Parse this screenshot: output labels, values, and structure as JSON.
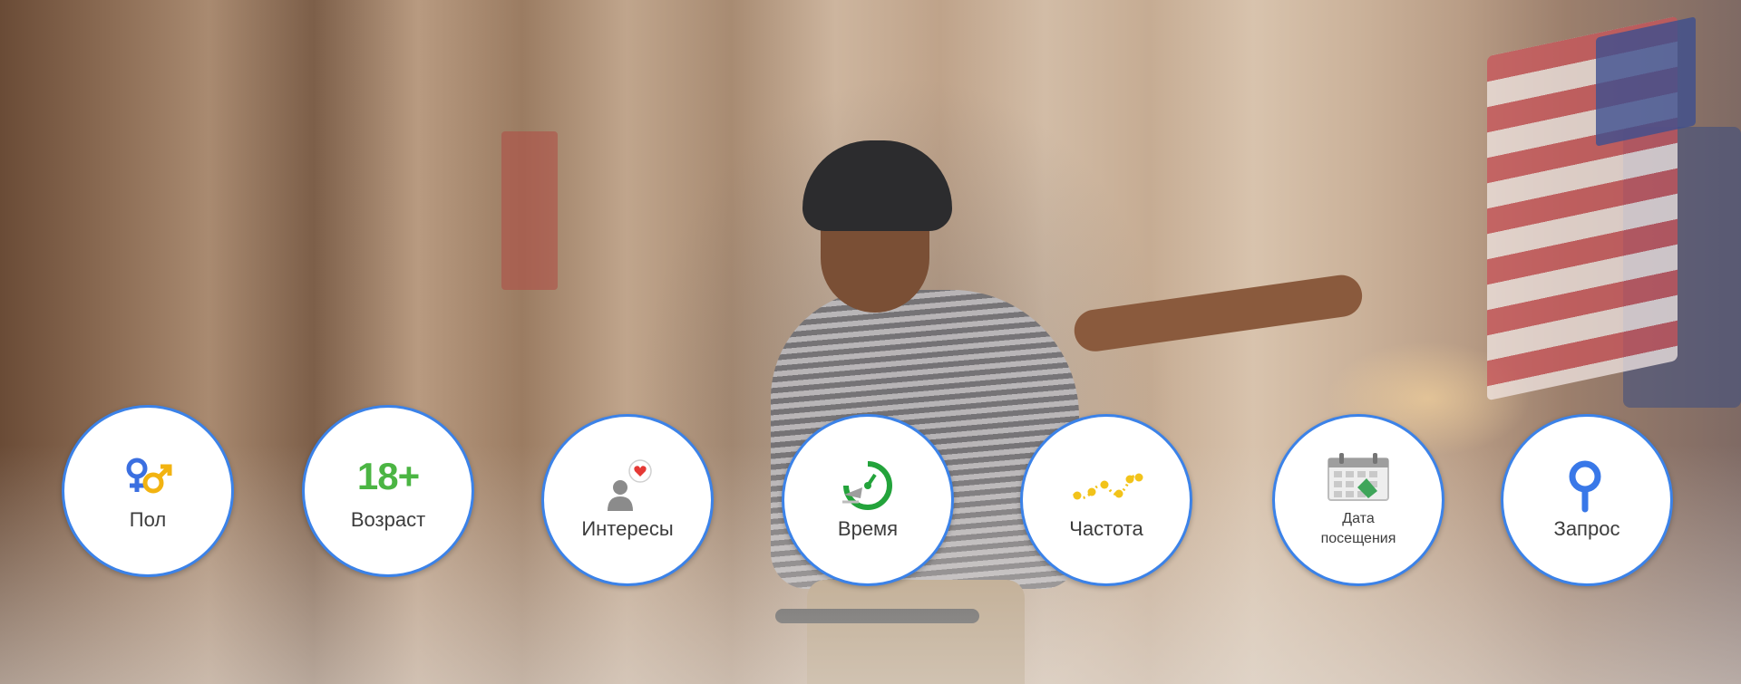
{
  "features": [
    {
      "label": "Пол",
      "icon": "gender-icon"
    },
    {
      "label": "Возраст",
      "icon": "age-icon",
      "icon_text": "18+"
    },
    {
      "label": "Интересы",
      "icon": "interests-icon"
    },
    {
      "label": "Время",
      "icon": "timer-icon"
    },
    {
      "label": "Частота",
      "icon": "frequency-icon"
    },
    {
      "label_line1": "Дата",
      "label_line2": "посещения",
      "icon": "calendar-icon"
    },
    {
      "label": "Запрос",
      "icon": "search-icon"
    }
  ],
  "colors": {
    "circle_border": "#3b82e8",
    "gender_female": "#3b6fe0",
    "gender_male": "#f2b311",
    "age": "#4bb543",
    "heart": "#e53935",
    "timer": "#23a33b",
    "frequency": "#f2c31a",
    "calendar_green": "#3fa55a",
    "search": "#3978e8"
  }
}
